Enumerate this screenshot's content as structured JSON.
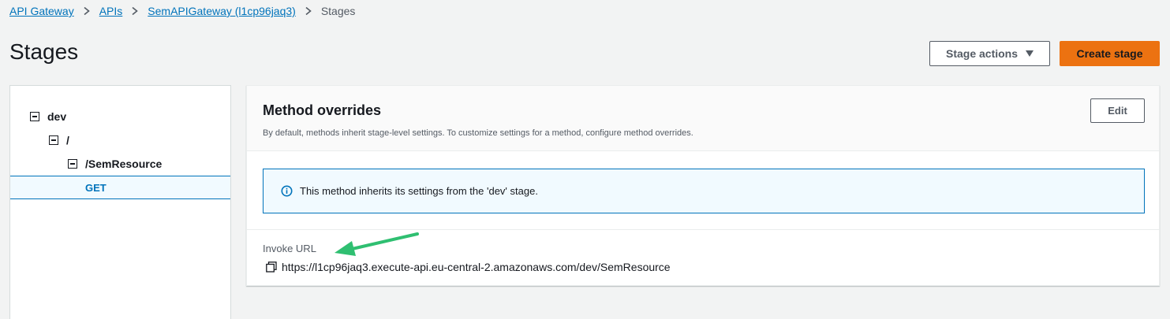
{
  "breadcrumb": {
    "items": [
      "API Gateway",
      "APIs",
      "SemAPIGateway (l1cp96jaq3)"
    ],
    "current": "Stages"
  },
  "page": {
    "title": "Stages"
  },
  "actions": {
    "stage_actions_label": "Stage actions",
    "create_stage_label": "Create stage"
  },
  "tree": {
    "nodes": [
      "dev",
      "/",
      "/SemResource"
    ],
    "selected": "GET"
  },
  "method_overrides": {
    "title": "Method overrides",
    "description": "By default, methods inherit stage-level settings. To customize settings for a method, configure method overrides.",
    "edit_label": "Edit",
    "info_message": "This method inherits its settings from the 'dev' stage.",
    "invoke_url_label": "Invoke URL",
    "invoke_url": "https://l1cp96jaq3.execute-api.eu-central-2.amazonaws.com/dev/SemResource"
  },
  "icons": {
    "breadcrumb_separator": "chevron-right-icon",
    "dropdown": "caret-down-icon",
    "tree_toggle": "collapse-icon",
    "info": "info-icon",
    "copy": "copy-icon",
    "annotation": "arrow-icon"
  },
  "colors": {
    "primary_button": "#ec7211",
    "link": "#0073bb",
    "selected_bg": "#f1faff",
    "annotation_arrow": "#2fbf71"
  }
}
